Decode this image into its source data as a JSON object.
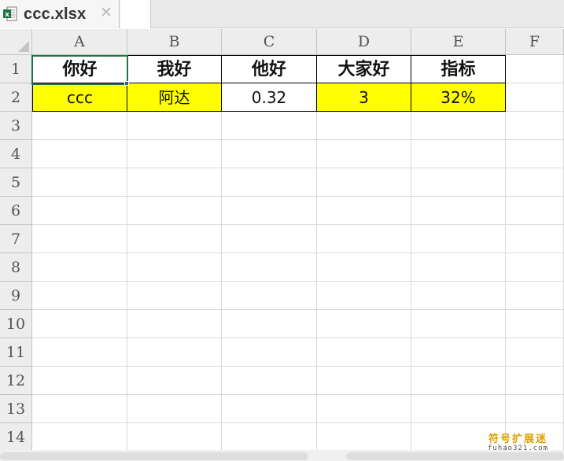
{
  "tab": {
    "file_name": "ccc.xlsx",
    "close_glyph": "✕"
  },
  "sheet": {
    "columns": [
      "A",
      "B",
      "C",
      "D",
      "E",
      "F"
    ],
    "rows": [
      "1",
      "2",
      "3",
      "4",
      "5",
      "6",
      "7",
      "8",
      "9",
      "10",
      "11",
      "12",
      "13",
      "14"
    ],
    "selected_cell": "A1",
    "cells": {
      "header": [
        "你好",
        "我好",
        "他好",
        "大家好",
        "指标"
      ],
      "data": [
        "ccc",
        "阿达",
        "0.32",
        "3",
        "32%"
      ]
    },
    "row2_fill": [
      "yellow",
      "yellow",
      "white",
      "yellow",
      "yellow"
    ]
  },
  "colors": {
    "highlight": "#ffff00",
    "selection": "#217346",
    "excel_icon": "#1e7145"
  },
  "watermark": {
    "cn": "符号扩展迷",
    "en": "fuhao321.com"
  }
}
